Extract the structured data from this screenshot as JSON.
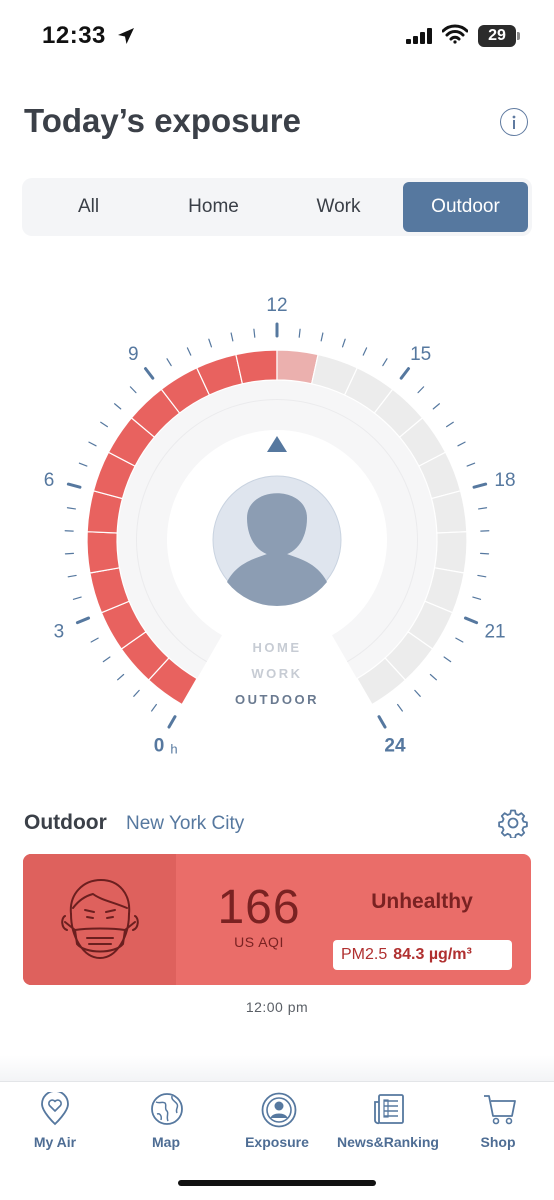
{
  "status_bar": {
    "time": "12:33",
    "battery": "29"
  },
  "header": {
    "title": "Today’s exposure",
    "info_icon": "info-icon"
  },
  "tabs": [
    {
      "label": "All",
      "active": false
    },
    {
      "label": "Home",
      "active": false
    },
    {
      "label": "Work",
      "active": false
    },
    {
      "label": "Outdoor",
      "active": true
    }
  ],
  "dial": {
    "hour_labels": [
      "0",
      "3",
      "6",
      "9",
      "12",
      "15",
      "18",
      "21",
      "24"
    ],
    "hour_unit": "h",
    "exposed_hours": 12.5,
    "colors": {
      "exposed": "#e8625f",
      "current_hour": "#ebb0ae",
      "remaining": "#ececec",
      "ticks": "#56789f"
    },
    "modes": [
      "HOME",
      "WORK",
      "OUTDOOR"
    ],
    "active_mode": "OUTDOOR"
  },
  "outdoor": {
    "title": "Outdoor",
    "city": "New York City",
    "aqi": "166",
    "aqi_unit": "US AQI",
    "status": "Unhealthy",
    "pollutant": "PM2.5",
    "concentration": "84.3 µg/m³",
    "time": "12:00 pm"
  },
  "nav": [
    {
      "label": "My Air",
      "icon": "heart-pin-icon"
    },
    {
      "label": "Map",
      "icon": "globe-icon"
    },
    {
      "label": "Exposure",
      "icon": "person-circle-icon"
    },
    {
      "label": "News&Ranking",
      "icon": "newspaper-icon"
    },
    {
      "label": "Shop",
      "icon": "cart-icon"
    }
  ]
}
